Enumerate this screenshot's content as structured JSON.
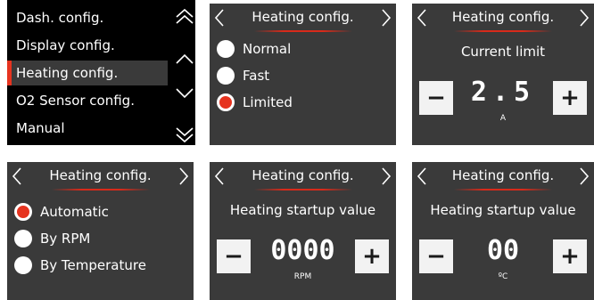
{
  "menu": {
    "items": [
      {
        "label": "Dash. config."
      },
      {
        "label": "Display config."
      },
      {
        "label": "Heating config."
      },
      {
        "label": "O2 Sensor config."
      },
      {
        "label": "Manual"
      }
    ],
    "selected_index": 2,
    "icons": [
      "double-chevron-up-icon",
      "chevron-up-icon",
      "chevron-down-icon",
      "double-chevron-down-icon"
    ]
  },
  "heating_mode": {
    "title": "Heating config.",
    "options": [
      {
        "label": "Normal",
        "selected": false
      },
      {
        "label": "Fast",
        "selected": false
      },
      {
        "label": "Limited",
        "selected": true
      }
    ]
  },
  "current_limit": {
    "title": "Heating config.",
    "caption": "Current limit",
    "value": "2.5",
    "unit": "A",
    "minus_label": "−",
    "plus_label": "+"
  },
  "heating_trigger": {
    "title": "Heating config.",
    "options": [
      {
        "label": "Automatic",
        "selected": true
      },
      {
        "label": "By RPM",
        "selected": false
      },
      {
        "label": "By Temperature",
        "selected": false
      }
    ]
  },
  "startup_rpm": {
    "title": "Heating config.",
    "caption": "Heating startup value",
    "value": "0000",
    "unit": "RPM",
    "minus_label": "−",
    "plus_label": "+"
  },
  "startup_temp": {
    "title": "Heating config.",
    "caption": "Heating startup value",
    "value": "00",
    "unit": "ºC",
    "minus_label": "−",
    "plus_label": "+"
  },
  "colors": {
    "panel_bg": "#3a3a3a",
    "menu_bg": "#000000",
    "accent": "#e6331f",
    "text": "#ffffff",
    "button_bg": "#f2f2f2"
  }
}
